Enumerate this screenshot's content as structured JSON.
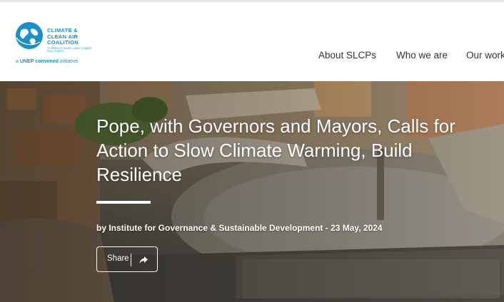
{
  "logo": {
    "line1": "CLIMATE &",
    "line2": "CLEAN AIR",
    "line3": "COALITION",
    "tagline": "TO REDUCE SHORT-LIVED CLIMATE POLLUTANTS",
    "convened_prefix": "a",
    "convened_org": "UNEP",
    "convened_bold": "convened",
    "convened_suffix": "initiative"
  },
  "nav": {
    "items": [
      {
        "label": "About SLCPs"
      },
      {
        "label": "Who we are"
      },
      {
        "label": "Our work"
      }
    ]
  },
  "article": {
    "title": "Pope, with Governors and Mayors, Calls for Action to Slow Climate Warming, Build Resilience",
    "byline": "by Institute for Governance & Sustainable Development - 23 May, 2024"
  },
  "share": {
    "label": "Share"
  },
  "colors": {
    "brand_blue": "#1a8fc9",
    "nav_text": "#333333"
  },
  "icons": {
    "logo": "globe-icon",
    "share": "share-arrow-icon"
  }
}
